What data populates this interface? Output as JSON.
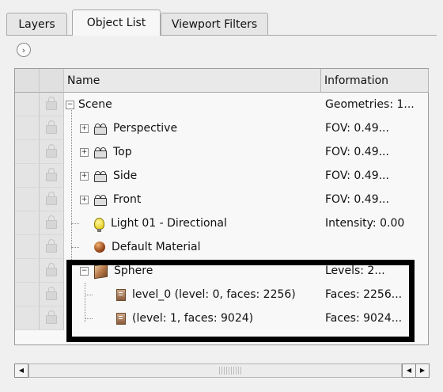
{
  "tabs": [
    {
      "label": "Layers",
      "active": false
    },
    {
      "label": "Object List",
      "active": true
    },
    {
      "label": "Viewport Filters",
      "active": false
    }
  ],
  "table": {
    "columns": [
      "Name",
      "Information"
    ],
    "rows": [
      {
        "name": "Scene",
        "info": "Geometries: 1...",
        "icon": "expand-minus",
        "depth": 0
      },
      {
        "name": "Perspective",
        "info": "FOV: 0.49...",
        "icon": "camera-icon",
        "depth": 1
      },
      {
        "name": "Top",
        "info": "FOV: 0.49...",
        "icon": "camera-icon",
        "depth": 1
      },
      {
        "name": "Side",
        "info": "FOV: 0.49...",
        "icon": "camera-icon",
        "depth": 1
      },
      {
        "name": "Front",
        "info": "FOV: 0.49...",
        "icon": "camera-icon",
        "depth": 1
      },
      {
        "name": "Light 01 - Directional",
        "info": "Intensity: 0.00",
        "icon": "light-bulb-icon",
        "depth": 1
      },
      {
        "name": "Default Material",
        "info": "",
        "icon": "material-ball-icon",
        "depth": 1
      },
      {
        "name": "Sphere",
        "info": "Levels: 2...",
        "icon": "mesh-icon",
        "depth": 1
      },
      {
        "name": "level_0 (level: 0, faces: 2256)",
        "info": "Faces: 2256...",
        "icon": "level-icon",
        "depth": 2
      },
      {
        "name": " (level: 1, faces: 9024)",
        "info": "Faces: 9024...",
        "icon": "level-icon",
        "depth": 2
      }
    ]
  },
  "colors": {
    "highlight_box": "#000000",
    "panel_bg": "#f8f8f8"
  }
}
